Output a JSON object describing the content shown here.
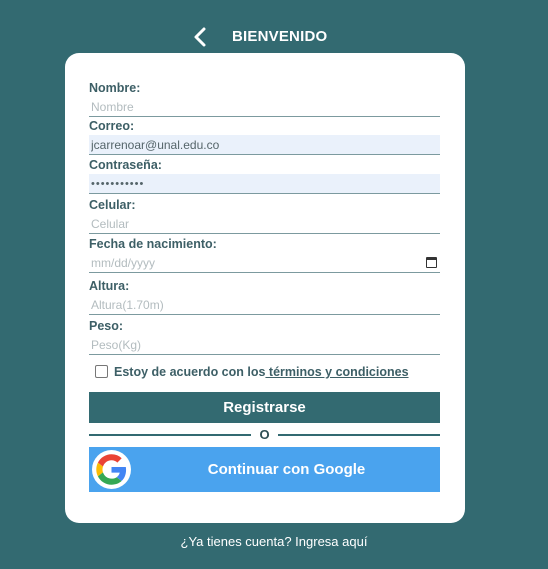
{
  "header": {
    "back_icon": "chevron-left-icon",
    "title": "BIENVENIDO"
  },
  "form": {
    "nombre": {
      "label": "Nombre:",
      "placeholder": "Nombre",
      "value": ""
    },
    "correo": {
      "label": "Correo:",
      "placeholder": "",
      "value": "jcarrenoar@unal.edu.co"
    },
    "contrasena": {
      "label": "Contraseña:",
      "placeholder": "",
      "value": "•••••••••••"
    },
    "celular": {
      "label": "Celular:",
      "placeholder": "Celular",
      "value": ""
    },
    "fecha": {
      "label": "Fecha de nacimiento:",
      "placeholder": "mm/dd/yyyy",
      "value": "",
      "icon": "calendar-icon"
    },
    "altura": {
      "label": "Altura:",
      "placeholder": "Altura(1.70m)",
      "value": ""
    },
    "peso": {
      "label": "Peso:",
      "placeholder": "Peso(Kg)",
      "value": ""
    }
  },
  "terms": {
    "checked": false,
    "text": "Estoy de acuerdo con los",
    "link_text": " términos y condiciones"
  },
  "register_button": "Registrarse",
  "divider_text": "O",
  "google_button": {
    "icon": "google-icon",
    "label": "Continuar con Google"
  },
  "footer_link": "¿Ya tienes cuenta? Ingresa aquí",
  "colors": {
    "background": "#336a71",
    "card": "#ffffff",
    "primary_button": "#336a71",
    "google_button": "#4aa3ee"
  }
}
